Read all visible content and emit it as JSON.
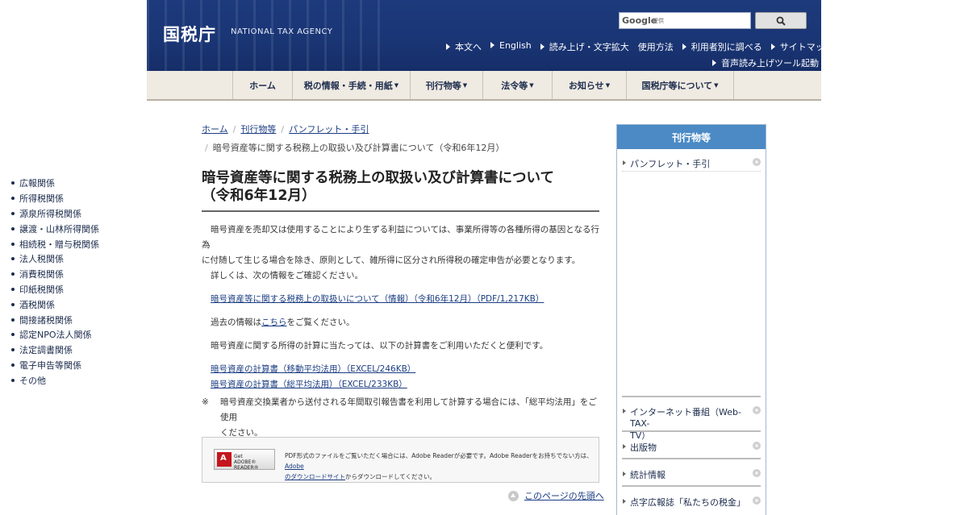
{
  "header": {
    "title": "国税庁",
    "subtitle": "NATIONAL TAX AGENCY",
    "search_logo": "Google",
    "search_provider": "提供",
    "util_links": [
      "本文へ",
      "English",
      "読み上げ・文字拡大",
      "使用方法",
      "利用者別に調べる",
      "サイトマップ"
    ],
    "voice_tool": "音声読み上げツール起動"
  },
  "gnav": {
    "items": [
      "ホーム",
      "税の情報・手続・用紙",
      "刊行物等",
      "法令等",
      "お知らせ",
      "国税庁等について"
    ]
  },
  "breadcrumb": {
    "home": "ホーム",
    "level1": "刊行物等",
    "level2": "パンフレット・手引",
    "current": "暗号資産等に関する税務上の取扱い及び計算書について（令和6年12月）"
  },
  "main": {
    "title_line1": "暗号資産等に関する税務上の取扱い及び計算書について",
    "title_line2": "（令和6年12月）",
    "para1_line1": "暗号資産を売却又は使用することにより生ずる利益については、事業所得等の各種所得の基因となる行為",
    "para1_line2": "に付随して生じる場合を除き、原則として、雑所得に区分され所得税の確定申告が必要となります。",
    "para1_line3": "詳しくは、次の情報をご確認ください。",
    "link_info": "暗号資産等に関する税務上の取扱いについて（情報）（令和6年12月）（PDF/1,217KB）",
    "past_prefix": "過去の情報は",
    "past_link": "こちら",
    "past_suffix": "をご覧ください。",
    "calc_intro": "暗号資産に関する所得の計算に当たっては、以下の計算書をご利用いただくと便利です。",
    "link_calc_moving": "暗号資産の計算書（移動平均法用）（EXCEL/246KB）",
    "link_calc_total": "暗号資産の計算書（総平均法用）（EXCEL/233KB）",
    "note_mark": "※",
    "note_line1": "暗号資産交換業者から送付される年間取引報告書を利用して計算する場合には、「総平均法用」をご使用",
    "note_line2": "ください。"
  },
  "adobe": {
    "btn_get": "Get",
    "btn_name": "ADOBE® READER®",
    "desc_line1": "PDF形式のファイルをご覧いただく場合には、Adobe Readerが必要です。Adobe Readerをお持ちでない方は、",
    "desc_link1": "Adobe",
    "desc_link2": "のダウンロードサイト",
    "desc_suffix": "からダウンロードしてください。"
  },
  "totop": "このページの先頭へ",
  "sidebar": {
    "title": "刊行物等",
    "section1": "パンフレット・手引",
    "items": [
      "広報関係",
      "所得税関係",
      "源泉所得税関係",
      "譲渡・山林所得関係",
      "相続税・贈与税関係",
      "法人税関係",
      "消費税関係",
      "印紙税関係",
      "酒税関係",
      "間接諸税関係",
      "認定NPO法人関係",
      "法定調書関係",
      "電子申告等関係",
      "その他"
    ],
    "section2_line1": "インターネット番組（Web-TAX-",
    "section2_line2": "TV）",
    "section3": "出版物",
    "section4": "統計情報",
    "section5": "点字広報誌「私たちの税金」"
  }
}
